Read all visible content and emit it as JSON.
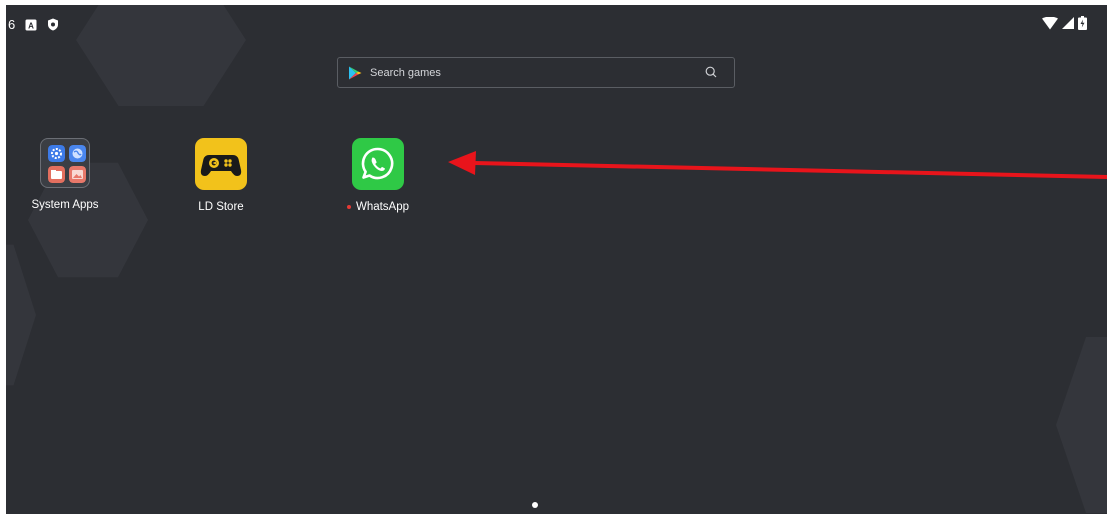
{
  "status_bar": {
    "left_number": "6",
    "icons": [
      "a-box-icon",
      "shield-icon"
    ],
    "right_icons": [
      "wifi-icon",
      "signal-icon",
      "battery-icon"
    ]
  },
  "search": {
    "placeholder": "Search games"
  },
  "apps": [
    {
      "label": "System Apps",
      "icon": "folder-icon"
    },
    {
      "label": "LD Store",
      "icon": "gamepad-icon"
    },
    {
      "label": "WhatsApp",
      "icon": "whatsapp-icon",
      "new_indicator": true
    }
  ],
  "pager": {
    "current": 1,
    "total": 1
  },
  "colors": {
    "background": "#2c2e33",
    "ldstore": "#f2c21b",
    "whatsapp": "#2fc946",
    "arrow": "#e8141b"
  },
  "annotation": {
    "type": "arrow",
    "target": "WhatsApp"
  }
}
